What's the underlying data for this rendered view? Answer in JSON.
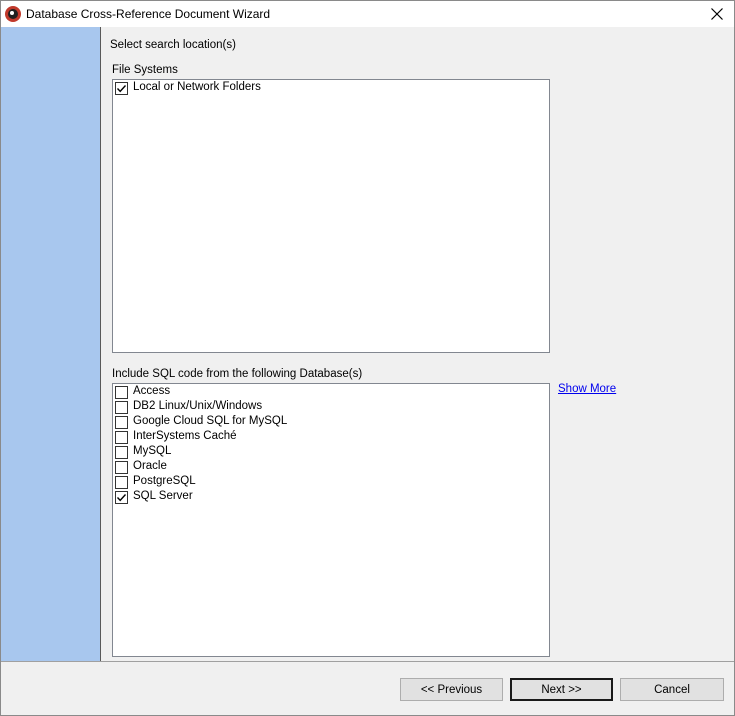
{
  "window": {
    "title": "Database Cross-Reference Document Wizard",
    "icon": "app-logo-icon",
    "close_icon": "close-icon"
  },
  "main": {
    "instruction": "Select search location(s)",
    "file_systems": {
      "label": "File Systems",
      "items": [
        {
          "label": "Local or Network Folders",
          "checked": true
        }
      ]
    },
    "databases": {
      "label": "Include SQL code from the following Database(s)",
      "show_more": "Show More",
      "items": [
        {
          "label": "Access",
          "checked": false
        },
        {
          "label": "DB2 Linux/Unix/Windows",
          "checked": false
        },
        {
          "label": "Google Cloud SQL for MySQL",
          "checked": false
        },
        {
          "label": "InterSystems Caché",
          "checked": false
        },
        {
          "label": "MySQL",
          "checked": false
        },
        {
          "label": "Oracle",
          "checked": false
        },
        {
          "label": "PostgreSQL",
          "checked": false
        },
        {
          "label": "SQL Server",
          "checked": true
        }
      ]
    }
  },
  "footer": {
    "previous": "<< Previous",
    "next": "Next >>",
    "cancel": "Cancel"
  },
  "colors": {
    "side_panel": "#a8c7ee",
    "link": "#0000ee"
  }
}
